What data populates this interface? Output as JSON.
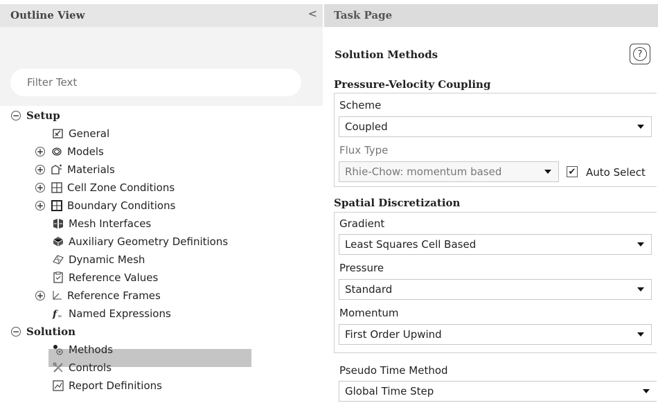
{
  "outline": {
    "title": "Outline View",
    "collapse_glyph": "<",
    "filter": {
      "placeholder": "Filter Text",
      "value": ""
    },
    "tree": [
      {
        "label": "Setup",
        "bold": true,
        "toggle": "minus",
        "icon": ""
      },
      {
        "label": "General",
        "icon": "general-icon"
      },
      {
        "label": "Models",
        "toggle": "plus",
        "icon": "models-icon"
      },
      {
        "label": "Materials",
        "toggle": "plus",
        "icon": "materials-icon"
      },
      {
        "label": "Cell Zone Conditions",
        "toggle": "plus",
        "icon": "cell-zone-icon"
      },
      {
        "label": "Boundary Conditions",
        "toggle": "plus",
        "icon": "boundary-icon"
      },
      {
        "label": "Mesh Interfaces",
        "icon": "mesh-interfaces-icon"
      },
      {
        "label": "Auxiliary Geometry Definitions",
        "icon": "auxiliary-geometry-icon"
      },
      {
        "label": "Dynamic Mesh",
        "icon": "dynamic-mesh-icon"
      },
      {
        "label": "Reference Values",
        "icon": "reference-values-icon"
      },
      {
        "label": "Reference Frames",
        "toggle": "plus",
        "icon": "reference-frames-icon"
      },
      {
        "label": "Named Expressions",
        "icon": "named-expressions-icon"
      },
      {
        "label": "Solution",
        "bold": true,
        "toggle": "minus",
        "icon": ""
      },
      {
        "label": "Methods",
        "icon": "methods-icon",
        "selected": true
      },
      {
        "label": "Controls",
        "icon": "controls-icon"
      },
      {
        "label": "Report Definitions",
        "icon": "report-definitions-icon"
      }
    ]
  },
  "task": {
    "title": "Task Page",
    "heading": "Solution Methods",
    "help_glyph": "?",
    "pvc": {
      "title": "Pressure-Velocity Coupling",
      "scheme_label": "Scheme",
      "scheme_value": "Coupled",
      "flux_label": "Flux Type",
      "flux_value": "Rhie-Chow: momentum based",
      "auto_select_label": "Auto Select",
      "auto_select_checked": true
    },
    "spatial": {
      "title": "Spatial Discretization",
      "gradient_label": "Gradient",
      "gradient_value": "Least Squares Cell Based",
      "pressure_label": "Pressure",
      "pressure_value": "Standard",
      "momentum_label": "Momentum",
      "momentum_value": "First Order Upwind"
    },
    "pseudo": {
      "label": "Pseudo Time Method",
      "value": "Global Time Step"
    }
  }
}
